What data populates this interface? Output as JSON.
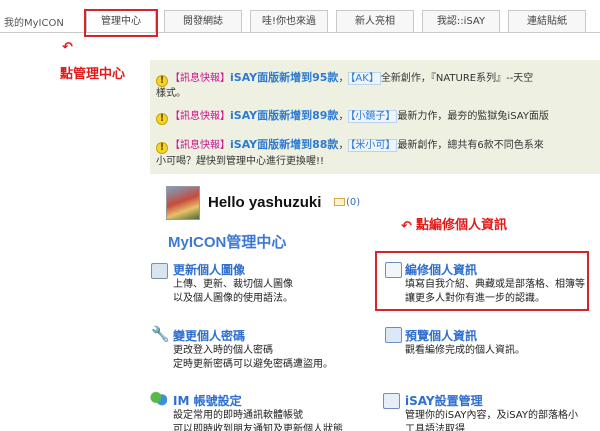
{
  "tabs": {
    "home": "我的MyICON",
    "items": [
      "管理中心",
      "閱發網誌",
      "哇!你也來過",
      "新人亮相",
      "我認::iSAY",
      "連結貼紙"
    ]
  },
  "annotations": {
    "click_manage": "點管理中心",
    "click_edit": "點編修個人資訊"
  },
  "news": [
    {
      "tag": "【訊息快報】",
      "headline": "iSAY面版新增到95款",
      "sep": "，",
      "author": "【AK】",
      "rest": "全新創作，『NATURE系列』--天空"
    },
    {
      "tag": "【訊息快報】",
      "headline": "iSAY面版新增到89款",
      "sep": "，",
      "author": "【小鏡子】",
      "rest": "最新力作，最夯的監獄兔iSAY面版"
    },
    {
      "tag": "【訊息快報】",
      "headline": "iSAY面版新增到88款",
      "sep": "，",
      "author": "【米小可】",
      "rest": "最新創作，總共有6款不同色系來"
    }
  ],
  "news_wraps": [
    "樣式。",
    "小可喝？趕快到管理中心進行更換喔!!"
  ],
  "greeting": {
    "hello": "Hello yashuzuki",
    "mail_count": "(0)"
  },
  "center_title": "MyICON管理中心",
  "items": {
    "update_image": {
      "title": "更新個人圖像",
      "desc1": "上傳、更新、裁切個人圖像",
      "desc2": "以及個人圖像的使用語法。"
    },
    "edit_info": {
      "title": "編修個人資訊",
      "desc1": "填寫自我介紹、典藏或是部落格、相簿等",
      "desc2": "讓更多人對你有進一步的認識。"
    },
    "change_password": {
      "title": "變更個人密碼",
      "desc1": "更改登入時的個人密碼",
      "desc2": "定時更新密碼可以避免密碼遭盜用。"
    },
    "preview_info": {
      "title": "預覽個人資訊",
      "desc1": "觀看編修完成的個人資訊。"
    },
    "im_settings": {
      "title": "IM 帳號設定",
      "desc1": "設定常用的即時通訊軟體帳號",
      "desc2": "可以即時收到朋友通知及更新個人狀態"
    },
    "isay_manage": {
      "title": "iSAY設置管理",
      "desc1": "管理你的iSAY內容，及iSAY的部落格小",
      "desc2": "工具語法取得"
    }
  }
}
